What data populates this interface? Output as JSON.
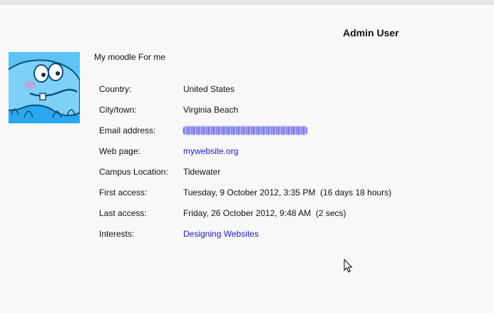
{
  "header": {
    "user_name": "Admin User"
  },
  "avatar": {
    "icon": "jellyfish-avatar-icon",
    "colors": {
      "sky": "#2aa8ef",
      "body": "#7fd0f7",
      "outline": "#0b4e7a"
    }
  },
  "profile": {
    "description": "My moodle For me",
    "fields": [
      {
        "label": "Country:",
        "value": "United States"
      },
      {
        "label": "City/town:",
        "value": "Virginia Beach"
      },
      {
        "label": "Email address:",
        "value": ""
      },
      {
        "label": "Web page:",
        "value": "mywebsite.org"
      },
      {
        "label": "Campus Location:",
        "value": "Tidewater"
      },
      {
        "label": "First access:",
        "value": "Tuesday, 9 October 2012, 3:35 PM  (16 days 18 hours)"
      },
      {
        "label": "Last access:",
        "value": "Friday, 26 October 2012, 9:48 AM  (2 secs)"
      },
      {
        "label": "Interests:",
        "value": "Designing Websites"
      }
    ]
  },
  "colors": {
    "link": "#1a1ad4",
    "background": "#f8f8f8"
  }
}
